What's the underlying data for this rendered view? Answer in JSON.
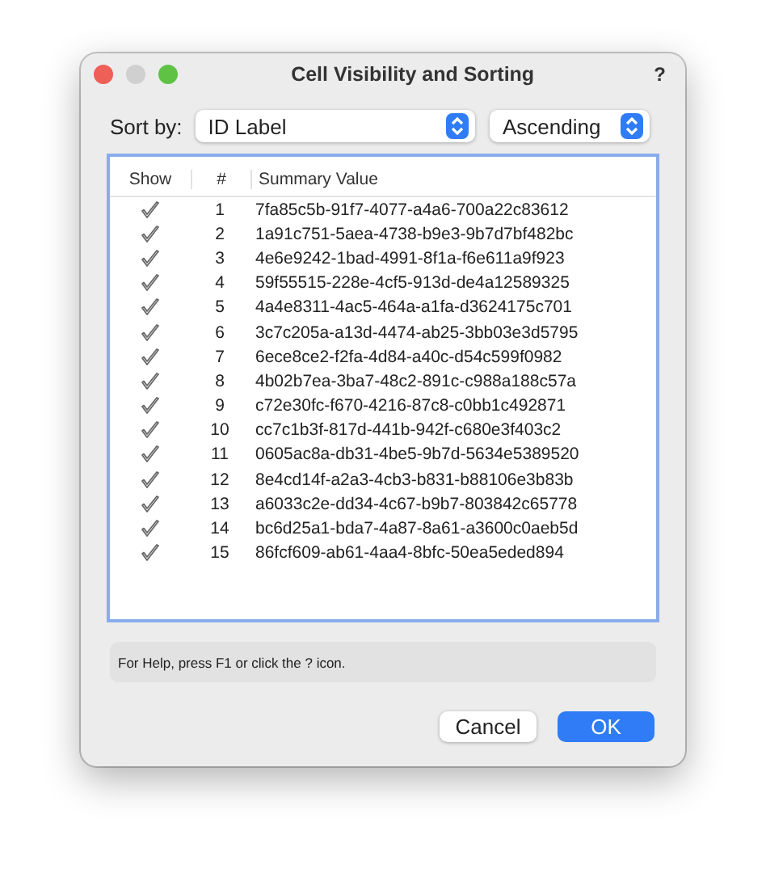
{
  "window": {
    "title": "Cell Visibility and Sorting",
    "help": "?"
  },
  "sort": {
    "label": "Sort by:",
    "field": "ID Label",
    "order": "Ascending"
  },
  "table": {
    "columns": [
      "Show",
      "#",
      "Summary Value"
    ],
    "rows": [
      {
        "show": true,
        "num": "1",
        "value": "7fa85c5b-91f7-4077-a4a6-700a22c83612"
      },
      {
        "show": true,
        "num": "2",
        "value": "1a91c751-5aea-4738-b9e3-9b7d7bf482bc"
      },
      {
        "show": true,
        "num": "3",
        "value": "4e6e9242-1bad-4991-8f1a-f6e611a9f923"
      },
      {
        "show": true,
        "num": "4",
        "value": "59f55515-228e-4cf5-913d-de4a12589325"
      },
      {
        "show": true,
        "num": "5",
        "value": "4a4e8311-4ac5-464a-a1fa-d3624175c701"
      },
      {
        "show": true,
        "num": "6",
        "value": "3c7c205a-a13d-4474-ab25-3bb03e3d5795"
      },
      {
        "show": true,
        "num": "7",
        "value": "6ece8ce2-f2fa-4d84-a40c-d54c599f0982"
      },
      {
        "show": true,
        "num": "8",
        "value": "4b02b7ea-3ba7-48c2-891c-c988a188c57a"
      },
      {
        "show": true,
        "num": "9",
        "value": "c72e30fc-f670-4216-87c8-c0bb1c492871"
      },
      {
        "show": true,
        "num": "10",
        "value": "cc7c1b3f-817d-441b-942f-c680e3f403c2"
      },
      {
        "show": true,
        "num": "11",
        "value": "0605ac8a-db31-4be5-9b7d-5634e5389520"
      },
      {
        "show": true,
        "num": "12",
        "value": "8e4cd14f-a2a3-4cb3-b831-b88106e3b83b"
      },
      {
        "show": true,
        "num": "13",
        "value": "a6033c2e-dd34-4c67-b9b7-803842c65778"
      },
      {
        "show": true,
        "num": "14",
        "value": "bc6d25a1-bda7-4a87-8a61-a3600c0aeb5d"
      },
      {
        "show": true,
        "num": "15",
        "value": "86fcf609-ab61-4aa4-8bfc-50ea5eded894"
      }
    ]
  },
  "status_bar": "For Help, press F1 or click the ? icon.",
  "buttons": [
    {
      "label": "Cancel",
      "kind": "secondary"
    },
    {
      "label": "OK",
      "kind": "primary"
    }
  ]
}
